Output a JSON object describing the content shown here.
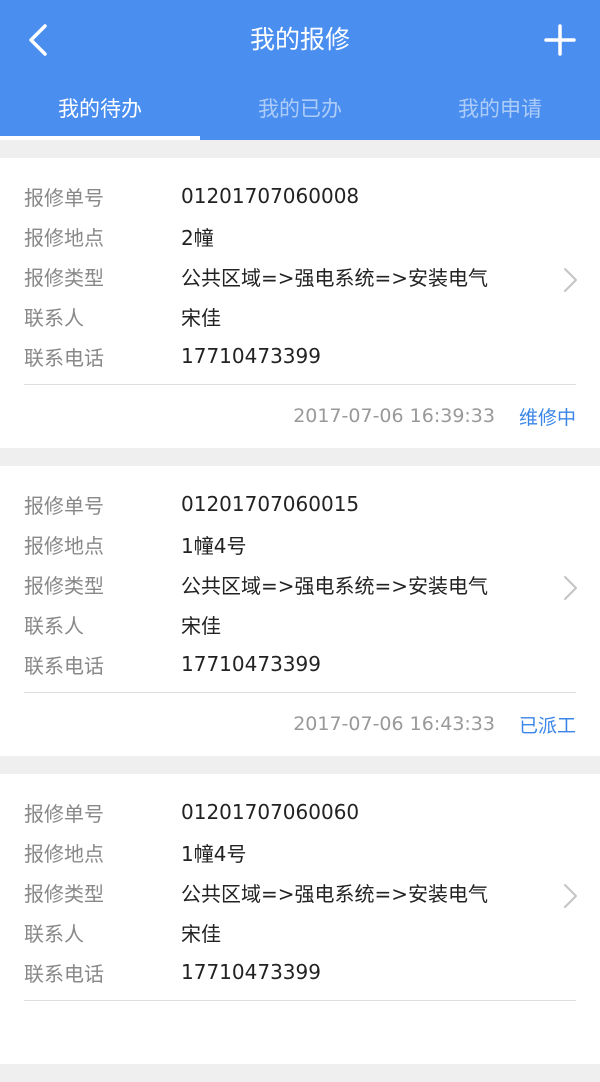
{
  "header": {
    "title": "我的报修",
    "back_icon": "chevron-left-icon",
    "add_icon": "plus-icon",
    "bg_color": "#4a8ef0"
  },
  "tabs": [
    {
      "label": "我的待办",
      "active": true
    },
    {
      "label": "我的已办",
      "active": false
    },
    {
      "label": "我的申请",
      "active": false
    }
  ],
  "labels": {
    "order_no": "报修单号",
    "location": "报修地点",
    "type": "报修类型",
    "contact": "联系人",
    "phone": "联系电话"
  },
  "cards": [
    {
      "order_no": "01201707060008",
      "location": "2幢",
      "type": "公共区域=>强电系统=>安装电气",
      "contact": "宋佳",
      "phone": "17710473399",
      "time": "2017-07-06 16:39:33",
      "status": "维修中"
    },
    {
      "order_no": "01201707060015",
      "location": "1幢4号",
      "type": "公共区域=>强电系统=>安装电气",
      "contact": "宋佳",
      "phone": "17710473399",
      "time": "2017-07-06 16:43:33",
      "status": "已派工"
    },
    {
      "order_no": "01201707060060",
      "location": "1幢4号",
      "type": "公共区域=>强电系统=>安装电气",
      "contact": "宋佳",
      "phone": "17710473399",
      "time": "",
      "status": ""
    }
  ],
  "accent_color": "#3a86e8"
}
